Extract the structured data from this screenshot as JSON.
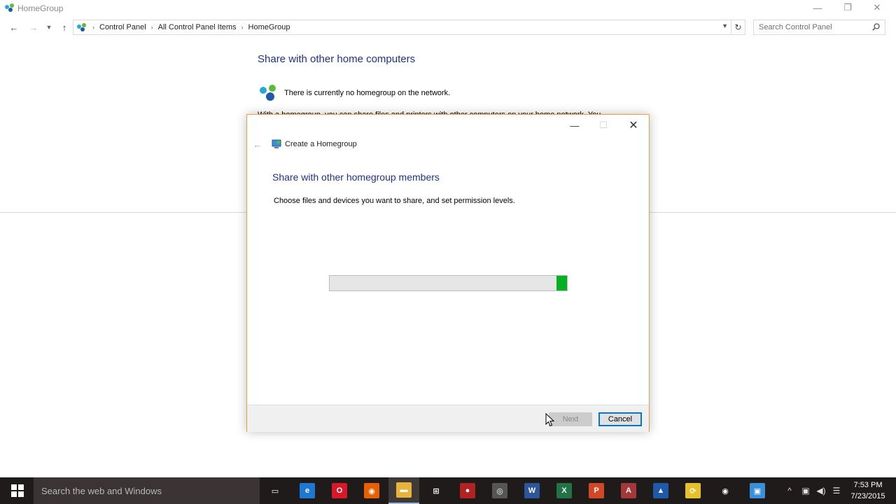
{
  "window": {
    "title": "HomeGroup",
    "controls": {
      "minimize": "—",
      "maximize": "❐",
      "close": "✕"
    }
  },
  "address": {
    "breadcrumbs": [
      "Control Panel",
      "All Control Panel Items",
      "HomeGroup"
    ],
    "separator": "›",
    "search_placeholder": "Search Control Panel"
  },
  "main": {
    "heading": "Share with other home computers",
    "status": "There is currently no homegroup on the network.",
    "partial_text": "With a homegroup, you can share files and printers with other computers on your home network. You"
  },
  "dialog": {
    "title": "Create a Homegroup",
    "heading": "Share with other homegroup members",
    "description": "Choose files and devices you want to share, and set permission levels.",
    "progress": {
      "position_fraction": 0.955,
      "segment_fraction": 0.045
    },
    "buttons": {
      "next": "Next",
      "cancel": "Cancel"
    },
    "controls": {
      "minimize": "—",
      "maximize": "☐",
      "close": "✕"
    }
  },
  "taskbar": {
    "search_placeholder": "Search the web and Windows",
    "apps": [
      {
        "name": "task-view-icon",
        "color": "#1f1b1b",
        "glyph": "▭"
      },
      {
        "name": "edge-icon",
        "color": "#1e78d2",
        "glyph": "e"
      },
      {
        "name": "opera-icon",
        "color": "#d7182a",
        "glyph": "O"
      },
      {
        "name": "firefox-icon",
        "color": "#e66000",
        "glyph": "◉"
      },
      {
        "name": "file-explorer-icon",
        "color": "#e8b33a",
        "glyph": "▬"
      },
      {
        "name": "store-icon",
        "color": "#1f1b1b",
        "glyph": "⊞"
      },
      {
        "name": "media-icon",
        "color": "#b22222",
        "glyph": "●"
      },
      {
        "name": "camera-icon",
        "color": "#555555",
        "glyph": "◎"
      },
      {
        "name": "word-icon",
        "color": "#2b579a",
        "glyph": "W"
      },
      {
        "name": "excel-icon",
        "color": "#217346",
        "glyph": "X"
      },
      {
        "name": "powerpoint-icon",
        "color": "#d24726",
        "glyph": "P"
      },
      {
        "name": "access-icon",
        "color": "#a4373a",
        "glyph": "A"
      },
      {
        "name": "network-app-icon",
        "color": "#1e5aa8",
        "glyph": "▲"
      },
      {
        "name": "sync-app-icon",
        "color": "#e8c12a",
        "glyph": "⟳"
      },
      {
        "name": "groove-icon",
        "color": "#1f1b1b",
        "glyph": "◉"
      },
      {
        "name": "control-panel-icon",
        "color": "#3a8fd8",
        "glyph": "▣"
      }
    ],
    "tray": {
      "chevron": "^",
      "network": "▣",
      "volume": "◀)",
      "notifications": "☰"
    },
    "time": "7:53 PM",
    "date": "7/23/2015"
  }
}
